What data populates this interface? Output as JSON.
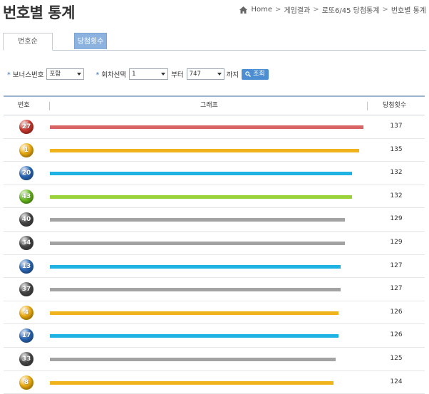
{
  "page": {
    "title": "번호별 통계"
  },
  "breadcrumb": {
    "items": [
      "Home",
      "게임결과",
      "로또6/45 당첨통계",
      "번호별 통계"
    ]
  },
  "tabs": [
    {
      "label": "번호순",
      "active": false
    },
    {
      "label": "당첨횟수순",
      "active": true
    }
  ],
  "filters": {
    "bonus_label": "보너스번호",
    "bonus_value": "포함",
    "round_label": "회차선택",
    "round_from": "1",
    "from_label": "부터",
    "round_to": "747",
    "to_label": "까지",
    "search_label": "조회"
  },
  "table": {
    "headers": {
      "number": "번호",
      "graph": "그래프",
      "count": "당첨횟수"
    },
    "max_count": 137,
    "rows": [
      {
        "number": "27",
        "count": 137,
        "ball_color": "#d13a2f",
        "bar_color": "#d96464"
      },
      {
        "number": "1",
        "count": 135,
        "ball_color": "#f2b011",
        "bar_color": "#f0b31c"
      },
      {
        "number": "20",
        "count": 132,
        "ball_color": "#2b6cbf",
        "bar_color": "#1fb3e3"
      },
      {
        "number": "43",
        "count": 132,
        "ball_color": "#6cc11f",
        "bar_color": "#9ad23a"
      },
      {
        "number": "40",
        "count": 129,
        "ball_color": "#4a4a4a",
        "bar_color": "#a3a3a3"
      },
      {
        "number": "34",
        "count": 129,
        "ball_color": "#4a4a4a",
        "bar_color": "#a3a3a3"
      },
      {
        "number": "13",
        "count": 127,
        "ball_color": "#2b6cbf",
        "bar_color": "#1fb3e3"
      },
      {
        "number": "37",
        "count": 127,
        "ball_color": "#4a4a4a",
        "bar_color": "#a3a3a3"
      },
      {
        "number": "4",
        "count": 126,
        "ball_color": "#f2b011",
        "bar_color": "#f0b31c"
      },
      {
        "number": "17",
        "count": 126,
        "ball_color": "#2b6cbf",
        "bar_color": "#1fb3e3"
      },
      {
        "number": "33",
        "count": 125,
        "ball_color": "#4a4a4a",
        "bar_color": "#a3a3a3"
      },
      {
        "number": "8",
        "count": 124,
        "ball_color": "#f2b011",
        "bar_color": "#f0b31c"
      }
    ]
  }
}
